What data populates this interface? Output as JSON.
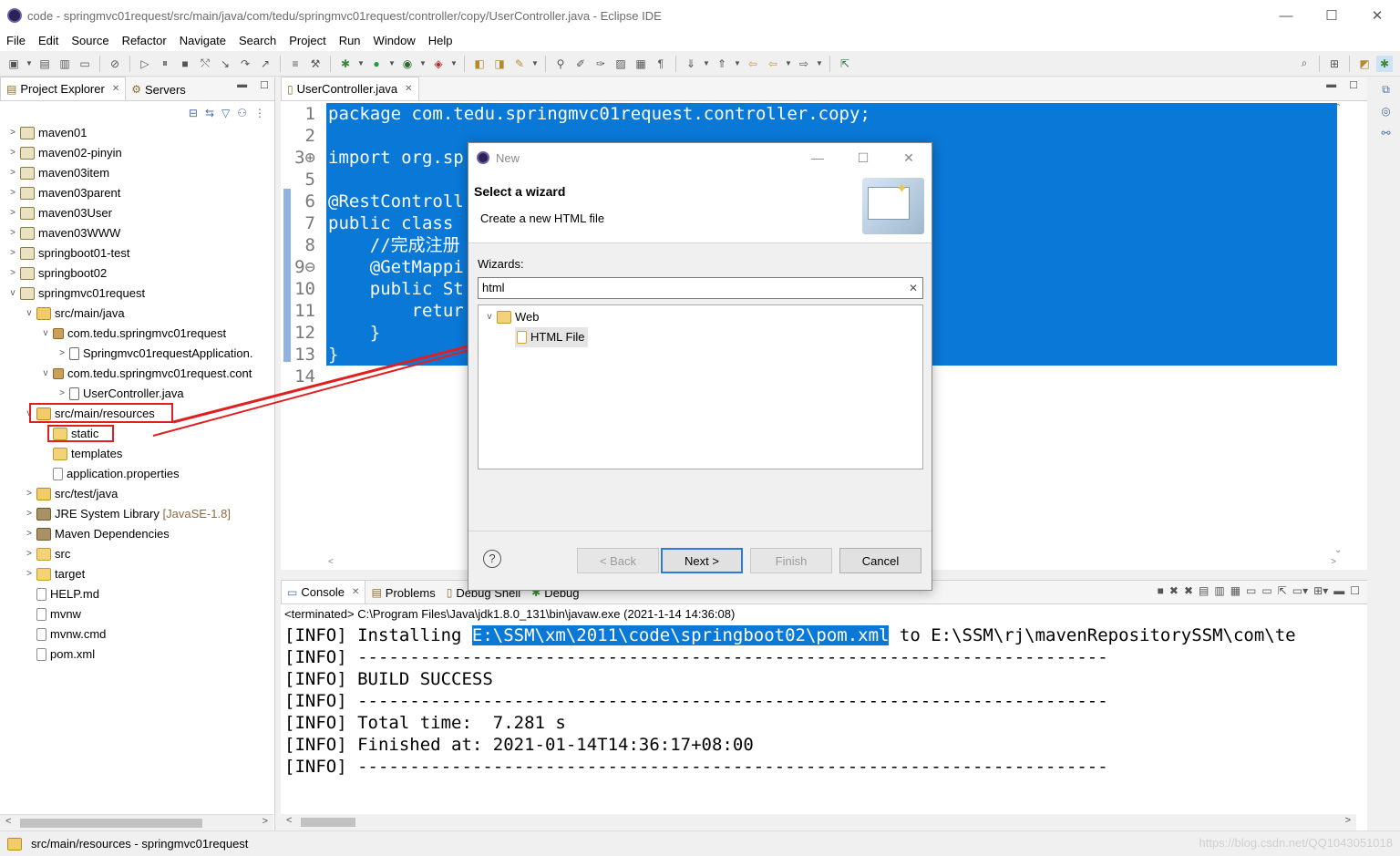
{
  "window": {
    "title": "code - springmvc01request/src/main/java/com/tedu/springmvc01request/controller/copy/UserController.java - Eclipse IDE",
    "minimize": "—",
    "maximize": "☐",
    "close": "✕"
  },
  "menu": [
    "File",
    "Edit",
    "Source",
    "Refactor",
    "Navigate",
    "Search",
    "Project",
    "Run",
    "Window",
    "Help"
  ],
  "left_panel": {
    "tabs": [
      {
        "label": "Project Explorer",
        "close": "✕"
      },
      {
        "label": "Servers"
      }
    ],
    "tree": [
      {
        "twisty": ">",
        "label": "maven01",
        "icon": "project-icon"
      },
      {
        "twisty": ">",
        "label": "maven02-pinyin",
        "icon": "project-icon"
      },
      {
        "twisty": ">",
        "label": "maven03item",
        "icon": "project-icon"
      },
      {
        "twisty": ">",
        "label": "maven03parent",
        "icon": "project-icon"
      },
      {
        "twisty": ">",
        "label": "maven03User",
        "icon": "project-icon"
      },
      {
        "twisty": ">",
        "label": "maven03WWW",
        "icon": "project-icon"
      },
      {
        "twisty": ">",
        "label": "springboot01-test",
        "icon": "project-icon"
      },
      {
        "twisty": ">",
        "label": "springboot02",
        "icon": "project-icon"
      },
      {
        "twisty": "v",
        "label": "springmvc01request",
        "icon": "project-icon"
      },
      {
        "twisty": "v",
        "label": "src/main/java",
        "icon": "source-folder-icon"
      },
      {
        "twisty": "v",
        "label": "com.tedu.springmvc01request",
        "icon": "package-icon"
      },
      {
        "twisty": ">",
        "label": "Springmvc01requestApplication.",
        "icon": "java-file-icon"
      },
      {
        "twisty": "v",
        "label": "com.tedu.springmvc01request.cont",
        "icon": "package-icon"
      },
      {
        "twisty": ">",
        "label": "UserController.java",
        "icon": "java-file-icon"
      },
      {
        "twisty": "v",
        "label": "src/main/resources",
        "icon": "source-folder-icon"
      },
      {
        "twisty": "",
        "label": "static",
        "icon": "folder-icon"
      },
      {
        "twisty": "",
        "label": "templates",
        "icon": "folder-icon"
      },
      {
        "twisty": "",
        "label": "application.properties",
        "icon": "file-icon"
      },
      {
        "twisty": ">",
        "label": "src/test/java",
        "icon": "source-folder-icon"
      },
      {
        "twisty": ">",
        "label": "JRE System Library",
        "suffix": "[JavaSE-1.8]",
        "icon": "library-icon"
      },
      {
        "twisty": ">",
        "label": "Maven Dependencies",
        "icon": "library-icon"
      },
      {
        "twisty": ">",
        "label": "src",
        "icon": "folder-icon"
      },
      {
        "twisty": ">",
        "label": "target",
        "icon": "folder-icon"
      },
      {
        "twisty": "",
        "label": "HELP.md",
        "icon": "file-icon"
      },
      {
        "twisty": "",
        "label": "mvnw",
        "icon": "file-icon"
      },
      {
        "twisty": "",
        "label": "mvnw.cmd",
        "icon": "file-icon"
      },
      {
        "twisty": "",
        "label": "pom.xml",
        "icon": "file-icon"
      }
    ]
  },
  "editor": {
    "tab_label": "UserController.java",
    "tab_close": "✕",
    "lines": [
      {
        "no": "1",
        "text": "package com.tedu.springmvc01request.controller.copy;"
      },
      {
        "no": "2",
        "text": ""
      },
      {
        "no": "3⊕",
        "text": "import org.sp                                      ng;□"
      },
      {
        "no": "5",
        "text": ""
      },
      {
        "no": "6",
        "text": "@RestControll"
      },
      {
        "no": "7",
        "text": "public class"
      },
      {
        "no": "8",
        "text": "    //完成注册"
      },
      {
        "no": "9⊖",
        "text": "    @GetMappi"
      },
      {
        "no": "10",
        "text": "    public St                                      word) {"
      },
      {
        "no": "11",
        "text": "        retur"
      },
      {
        "no": "12",
        "text": "    }"
      },
      {
        "no": "13",
        "text": "}"
      },
      {
        "no": "14",
        "text": ""
      }
    ]
  },
  "console": {
    "tabs": [
      {
        "label": "Console",
        "close": "✕"
      },
      {
        "label": "Problems"
      },
      {
        "label": "Debug Shell"
      },
      {
        "label": "Debug"
      }
    ],
    "terminated": "<terminated> C:\\Program Files\\Java\\jdk1.8.0_131\\bin\\javaw.exe (2021-1-14 14:36:08)",
    "line1_prefix": "[INFO] Installing ",
    "line1_selected": "E:\\SSM\\xm\\2011\\code\\springboot02\\pom.xml",
    "line1_suffix": " to E:\\SSM\\rj\\mavenRepositorySSM\\com\\te",
    "lines": [
      "[INFO] ------------------------------------------------------------------------",
      "[INFO] BUILD SUCCESS",
      "[INFO] ------------------------------------------------------------------------",
      "[INFO] Total time:  7.281 s",
      "[INFO] Finished at: 2021-01-14T14:36:17+08:00",
      "[INFO] ------------------------------------------------------------------------"
    ]
  },
  "dialog": {
    "title": "New",
    "heading": "Select a wizard",
    "description": "Create a new HTML file",
    "wizards_label": "Wizards:",
    "filter_value": "html",
    "filter_clear": "✕",
    "tree": [
      {
        "twisty": "v",
        "label": "Web",
        "icon": "folder-icon"
      },
      {
        "label": "HTML File",
        "icon": "html-file-icon"
      }
    ],
    "help": "?",
    "buttons": {
      "back": "< Back",
      "next": "Next >",
      "finish": "Finish",
      "cancel": "Cancel"
    }
  },
  "status": {
    "text": "src/main/resources - springmvc01request",
    "watermark": "https://blog.csdn.net/QQ1043051018"
  },
  "colors": {
    "selection": "#0a78d7",
    "annotation": "#e02020"
  }
}
